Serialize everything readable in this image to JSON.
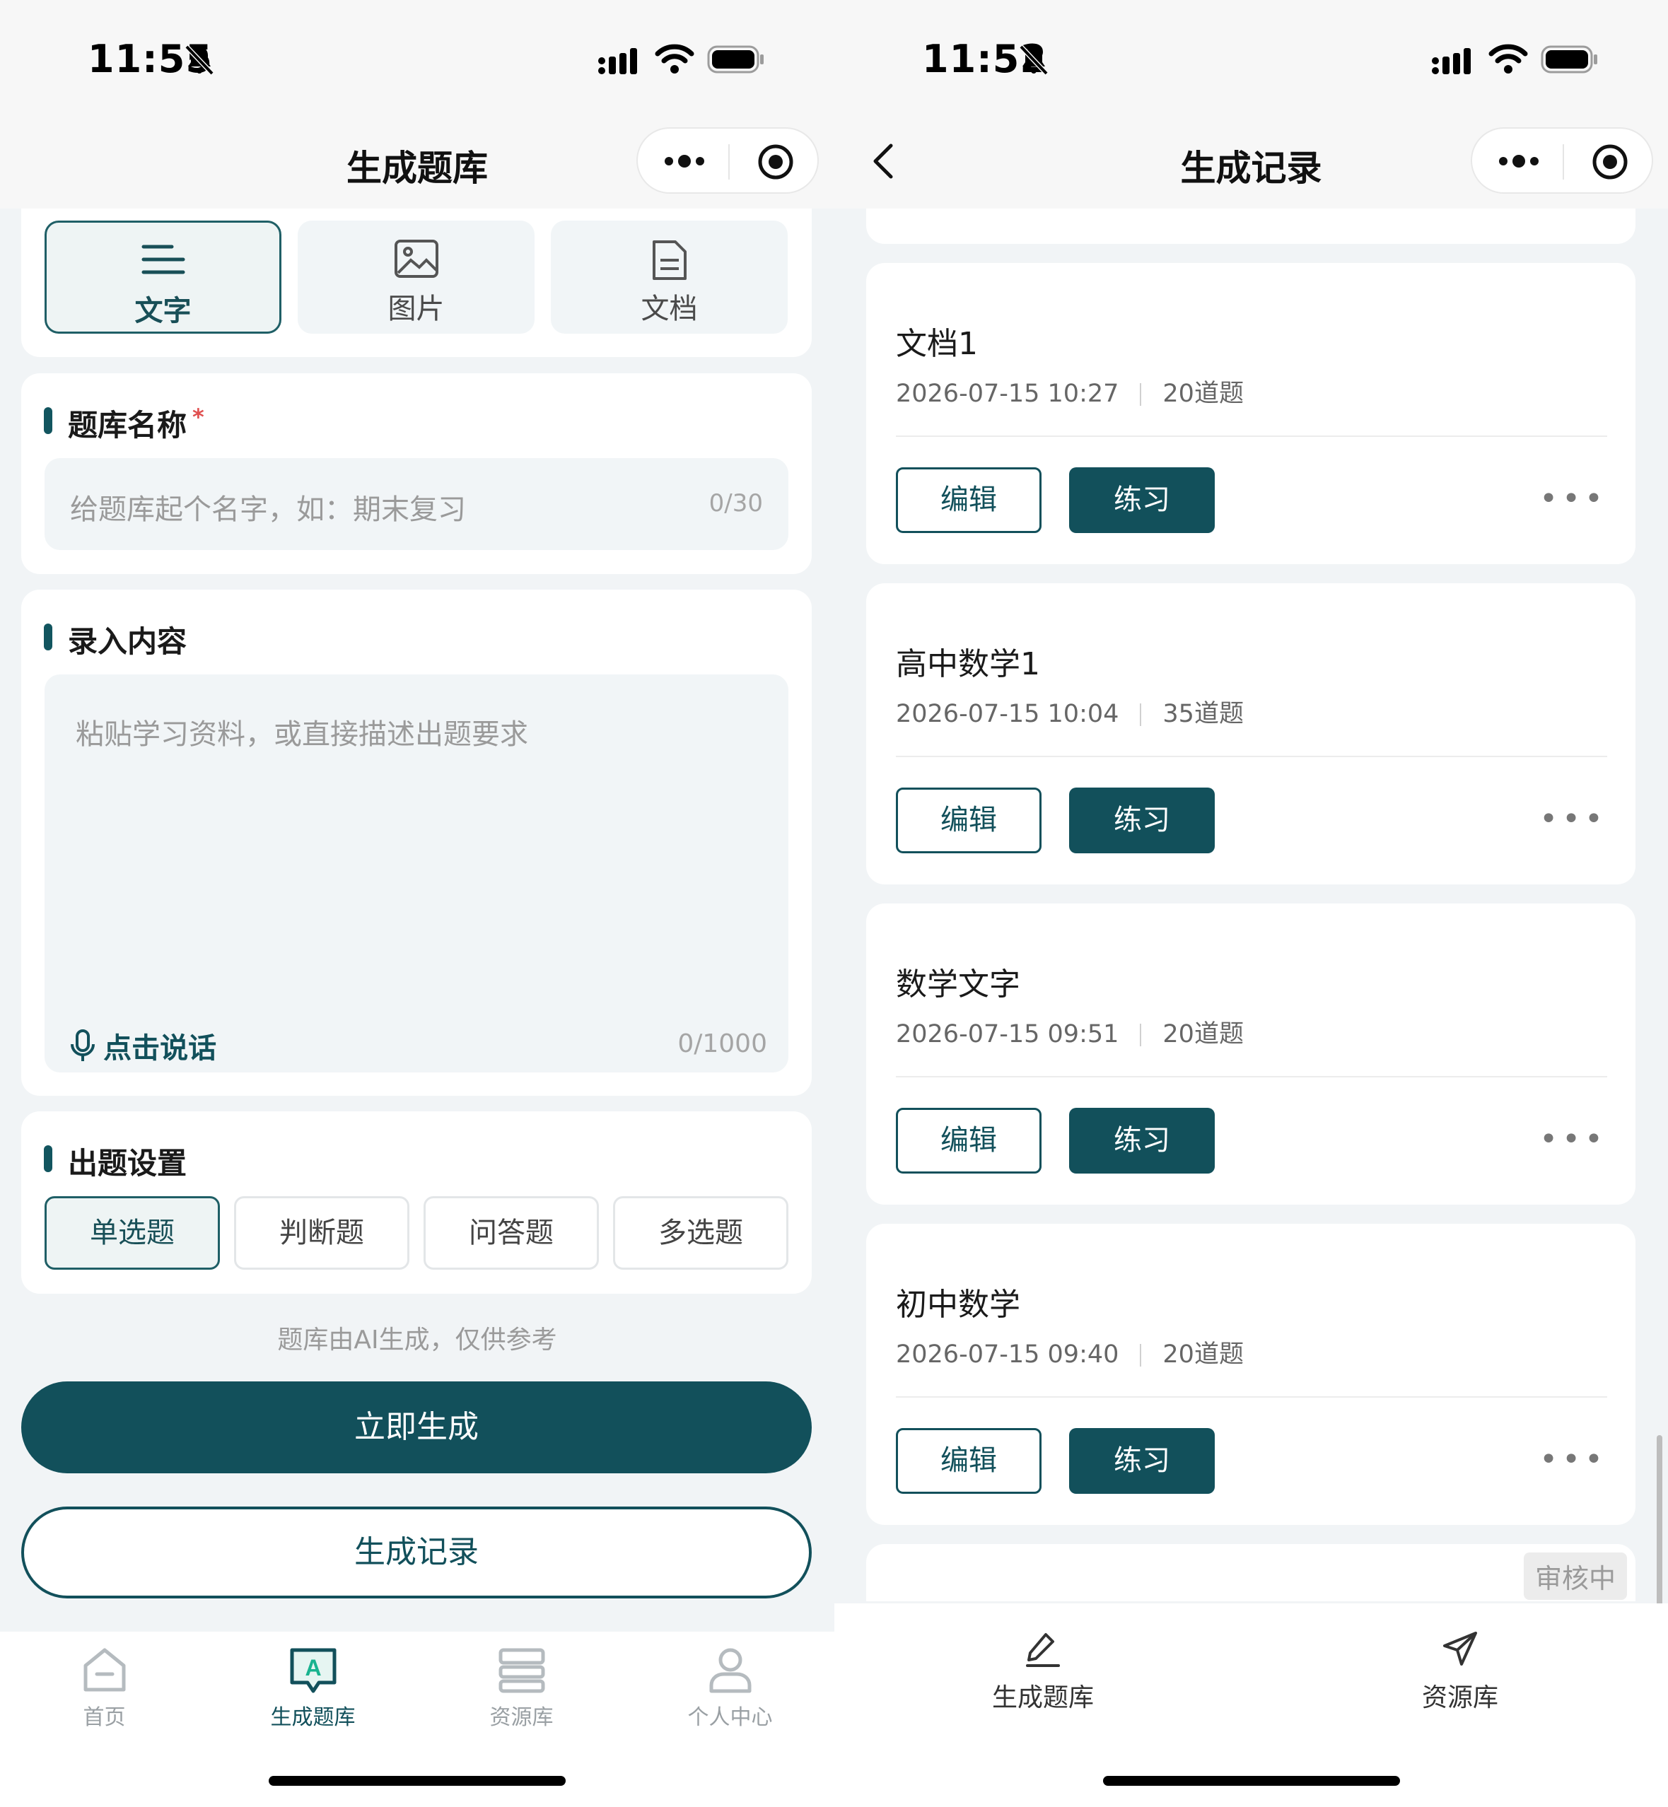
{
  "left": {
    "status": {
      "time": "11:55"
    },
    "nav": {
      "title": "生成题库"
    },
    "input_tabs": [
      {
        "label": "文字",
        "icon": "text-lines-icon",
        "active": true
      },
      {
        "label": "图片",
        "icon": "image-icon",
        "active": false
      },
      {
        "label": "文档",
        "icon": "document-icon",
        "active": false
      }
    ],
    "bank_name": {
      "title": "题库名称",
      "required_mark": "*",
      "placeholder": "给题库起个名字，如：期末复习",
      "counter": "0/30"
    },
    "content": {
      "title": "录入内容",
      "placeholder": "粘贴学习资料，或直接描述出题要求",
      "voice_label": "点击说话",
      "counter": "0/1000"
    },
    "settings": {
      "title": "出题设置",
      "question_types": [
        {
          "label": "单选题",
          "active": true
        },
        {
          "label": "判断题",
          "active": false
        },
        {
          "label": "问答题",
          "active": false
        },
        {
          "label": "多选题",
          "active": false
        }
      ]
    },
    "disclaimer": "题库由AI生成，仅供参考",
    "generate_button": "立即生成",
    "records_button": "生成记录",
    "tabbar": [
      {
        "label": "首页",
        "icon": "home-icon",
        "active": false
      },
      {
        "label": "生成题库",
        "icon": "ai-chat-icon",
        "active": true
      },
      {
        "label": "资源库",
        "icon": "library-icon",
        "active": false
      },
      {
        "label": "个人中心",
        "icon": "user-icon",
        "active": false
      }
    ]
  },
  "right": {
    "status": {
      "time": "11:52"
    },
    "nav": {
      "title": "生成记录"
    },
    "records": [
      {
        "title": "文档1",
        "date": "2026-07-15 10:27",
        "count": "20道题",
        "edit": "编辑",
        "practice": "练习"
      },
      {
        "title": "高中数学1",
        "date": "2026-07-15 10:04",
        "count": "35道题",
        "edit": "编辑",
        "practice": "练习"
      },
      {
        "title": "数学文字",
        "date": "2026-07-15 09:51",
        "count": "20道题",
        "edit": "编辑",
        "practice": "练习"
      },
      {
        "title": "初中数学",
        "date": "2026-07-15 09:40",
        "count": "20道题",
        "edit": "编辑",
        "practice": "练习"
      }
    ],
    "more_label": "•••",
    "pending_badge": "审核中",
    "tabbar": [
      {
        "label": "生成题库",
        "icon": "pencil-icon"
      },
      {
        "label": "资源库",
        "icon": "send-icon"
      }
    ]
  },
  "colors": {
    "primary": "#12505b",
    "background": "#f1f4f6",
    "required": "#e05050"
  }
}
